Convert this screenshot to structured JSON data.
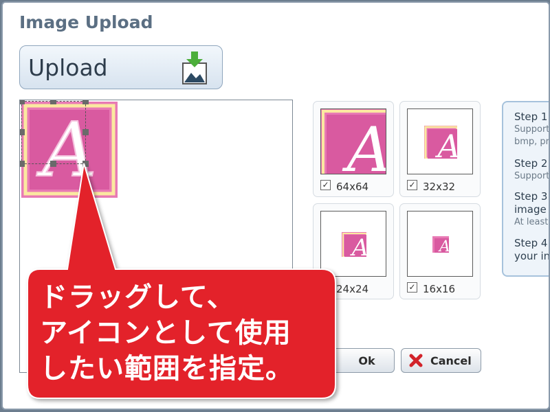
{
  "dialog": {
    "title": "Image Upload"
  },
  "upload": {
    "label": "Upload",
    "icon": "upload-image-icon"
  },
  "thumbnails": [
    {
      "label": "64x64",
      "checked": true
    },
    {
      "label": "32x32",
      "checked": true
    },
    {
      "label": "24x24",
      "checked": false
    },
    {
      "label": "16x16",
      "checked": true
    }
  ],
  "steps": [
    {
      "title": "Step 1",
      "lines": [
        "Support",
        "bmp, pr"
      ]
    },
    {
      "title": "Step 2",
      "lines": [
        "Support"
      ]
    },
    {
      "title": "Step 3",
      "lines": [
        "image",
        "At least"
      ]
    },
    {
      "title": "Step 4",
      "lines": [
        "your in"
      ]
    }
  ],
  "buttons": {
    "ok": "Ok",
    "cancel": "Cancel"
  },
  "callout": {
    "lines": [
      "ドラッグして、",
      "アイコンとして使用",
      "したい範囲を指定。"
    ]
  },
  "colors": {
    "callout": "#e3202a",
    "accent": "#5b6f83",
    "image_pink": "#e66aaa"
  }
}
